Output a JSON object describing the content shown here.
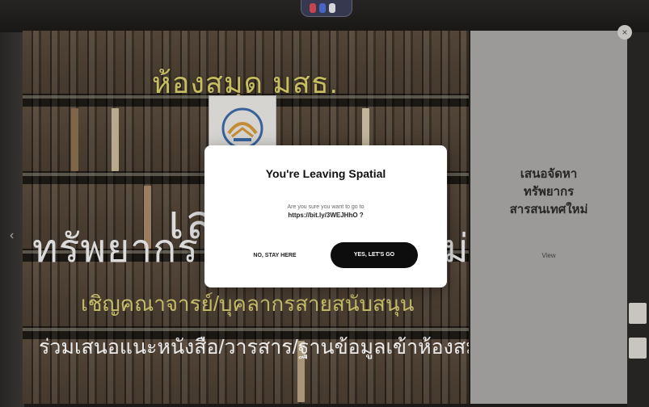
{
  "poster": {
    "title": "ห้องสมุด มสธ.",
    "big_line1": "เสน",
    "big_line2": "ทรัพยากร",
    "big_line2_tail": "ม่",
    "invite": "เชิญคณาจารย์/บุคลากรสายสนับสนุน",
    "join": "ร่วมเสนอแนะหนังสือ/วารสาร/ฐานข้อมูลเข้าห้องสมุด"
  },
  "side_panel": {
    "title": "เสนอจัดหา\nทรัพยากร\nสารสนเทศใหม่",
    "view_label": "View"
  },
  "close_label": "×",
  "left_arrow": "‹",
  "modal": {
    "title": "You're Leaving Spatial",
    "question": "Are you sure you want to go to",
    "url": "https://bit.ly/3WEJHhO ?",
    "stay_label": "NO, STAY HERE",
    "go_label": "YES, LET'S GO"
  },
  "colors": {
    "modal_bg": "#ffffff",
    "primary_button": "#0d0d0d",
    "poster_title": "#d8cf6a",
    "side_panel": "#aaa8a6"
  },
  "icons": [
    "close-icon",
    "chevron-left-icon",
    "logo-icon"
  ]
}
